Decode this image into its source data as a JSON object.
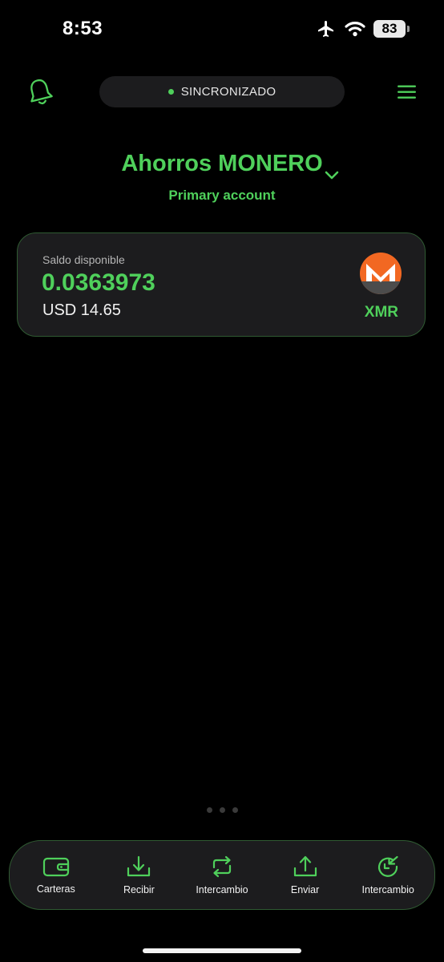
{
  "status_bar": {
    "time": "8:53",
    "battery_level": "83",
    "icons": [
      "airplane-icon",
      "wifi-icon",
      "battery-icon"
    ]
  },
  "top_bar": {
    "sync_status": "SINCRONIZADO",
    "icons": [
      "bell-icon",
      "hamburger-menu-icon"
    ]
  },
  "wallet": {
    "name": "Ahorros MONERO",
    "account": "Primary account"
  },
  "balance_card": {
    "label": "Saldo disponible",
    "amount": "0.0363973",
    "fiat": "USD 14.65",
    "currency": "XMR",
    "currency_icon": "monero-logo"
  },
  "pager": {
    "page_count": 3
  },
  "bottom_nav": {
    "items": [
      {
        "label": "Carteras",
        "icon": "wallet-icon"
      },
      {
        "label": "Recibir",
        "icon": "download-icon"
      },
      {
        "label": "Intercambio",
        "icon": "exchange-icon"
      },
      {
        "label": "Enviar",
        "icon": "upload-icon"
      },
      {
        "label": "Intercambio",
        "icon": "swap-circle-icon"
      }
    ]
  },
  "colors": {
    "background": "#000000",
    "accent": "#4fd05b",
    "card": "#1c1c1e",
    "card_border": "#2f5a32",
    "monero_orange": "#f26822"
  }
}
